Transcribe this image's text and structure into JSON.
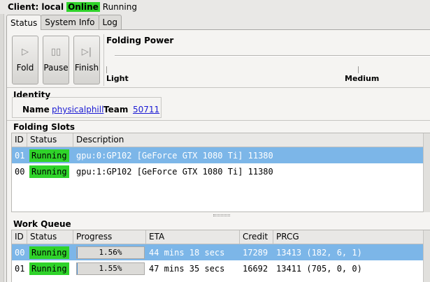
{
  "client": {
    "label": "Client: local",
    "online": "Online",
    "state": "Running"
  },
  "tabs": [
    {
      "label": "Status"
    },
    {
      "label": "System Info"
    },
    {
      "label": "Log"
    }
  ],
  "controls": {
    "fold": "Fold",
    "pause": "Pause",
    "finish": "Finish"
  },
  "power": {
    "title": "Folding Power",
    "light": "Light",
    "medium": "Medium"
  },
  "identity": {
    "title": "Identity",
    "name_label": "Name",
    "name": "physicalphill",
    "team_label": "Team",
    "team": "50711"
  },
  "slots": {
    "title": "Folding Slots",
    "headers": [
      "ID",
      "Status",
      "Description"
    ],
    "rows": [
      {
        "id": "01",
        "status": "Running",
        "description": "gpu:0:GP102 [GeForce GTX 1080 Ti] 11380"
      },
      {
        "id": "00",
        "status": "Running",
        "description": "gpu:1:GP102 [GeForce GTX 1080 Ti] 11380"
      }
    ]
  },
  "queue": {
    "title": "Work Queue",
    "headers": [
      "ID",
      "Status",
      "Progress",
      "ETA",
      "Credit",
      "PRCG"
    ],
    "rows": [
      {
        "id": "00",
        "status": "Running",
        "progress": "1.56%",
        "progress_value": 0.0156,
        "eta": "44 mins 18 secs",
        "credit": "17289",
        "prcg": "13413 (182, 6, 1)"
      },
      {
        "id": "01",
        "status": "Running",
        "progress": "1.55%",
        "progress_value": 0.0155,
        "eta": "47 mins 35 secs",
        "credit": "16692",
        "prcg": "13411 (705, 0, 0)"
      }
    ]
  },
  "colors": {
    "online": "#2fd32a",
    "selected_row": "#7cb6e8",
    "link": "#1a1ad3"
  }
}
